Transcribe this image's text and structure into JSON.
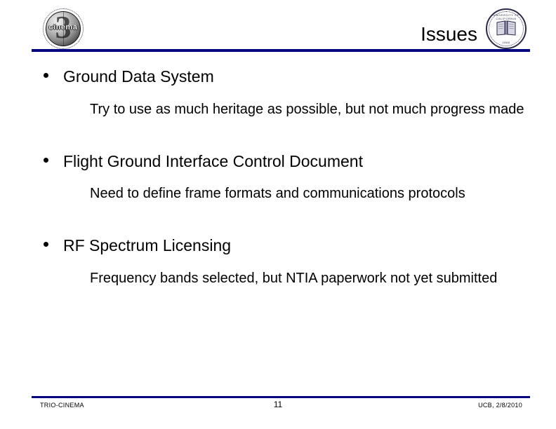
{
  "slide": {
    "title": "Issues",
    "accent_color": "#000080",
    "background_color": "#ffffff",
    "text_color": "#000000"
  },
  "logos": {
    "left": {
      "name": "cinema-3-logo",
      "word": "cinema",
      "numeral": "3"
    },
    "right": {
      "name": "uc-berkeley-seal",
      "motto_top": "UNIVERSITY OF CALIFORNIA",
      "motto_bottom": "1868"
    }
  },
  "content": {
    "bullets": [
      {
        "label": "Ground Data System",
        "detail": "Try to use as much heritage as possible, but not much progress made"
      },
      {
        "label": "Flight Ground Interface Control Document",
        "detail": "Need to define frame formats and communications protocols"
      },
      {
        "label": "RF Spectrum Licensing",
        "detail": "Frequency bands selected, but NTIA paperwork not yet submitted"
      }
    ]
  },
  "footer": {
    "left": "TRIO-CINEMA",
    "page_number": "11",
    "right": "UCB, 2/8/2010"
  }
}
